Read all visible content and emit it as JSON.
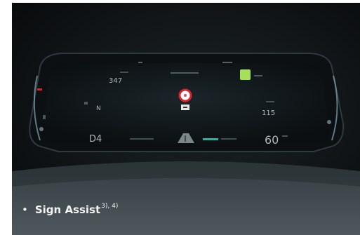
{
  "caption": {
    "bullet": "•",
    "title": "Sign Assist",
    "footnote": "3), 4)"
  },
  "cluster": {
    "left_readout": "347",
    "gear_letter": "N",
    "right_readout": "115",
    "gear": "D4",
    "speed": "60",
    "colors": {
      "accent_green": "#a6e05a",
      "sign_red": "#d8242a",
      "teal": "#35c2ae",
      "gauge_glow": "#7fa9b8"
    },
    "icons": [
      "speed-limit-sign-icon",
      "traffic-sign-icon",
      "road-lane-icon",
      "warning-light-icon"
    ]
  }
}
